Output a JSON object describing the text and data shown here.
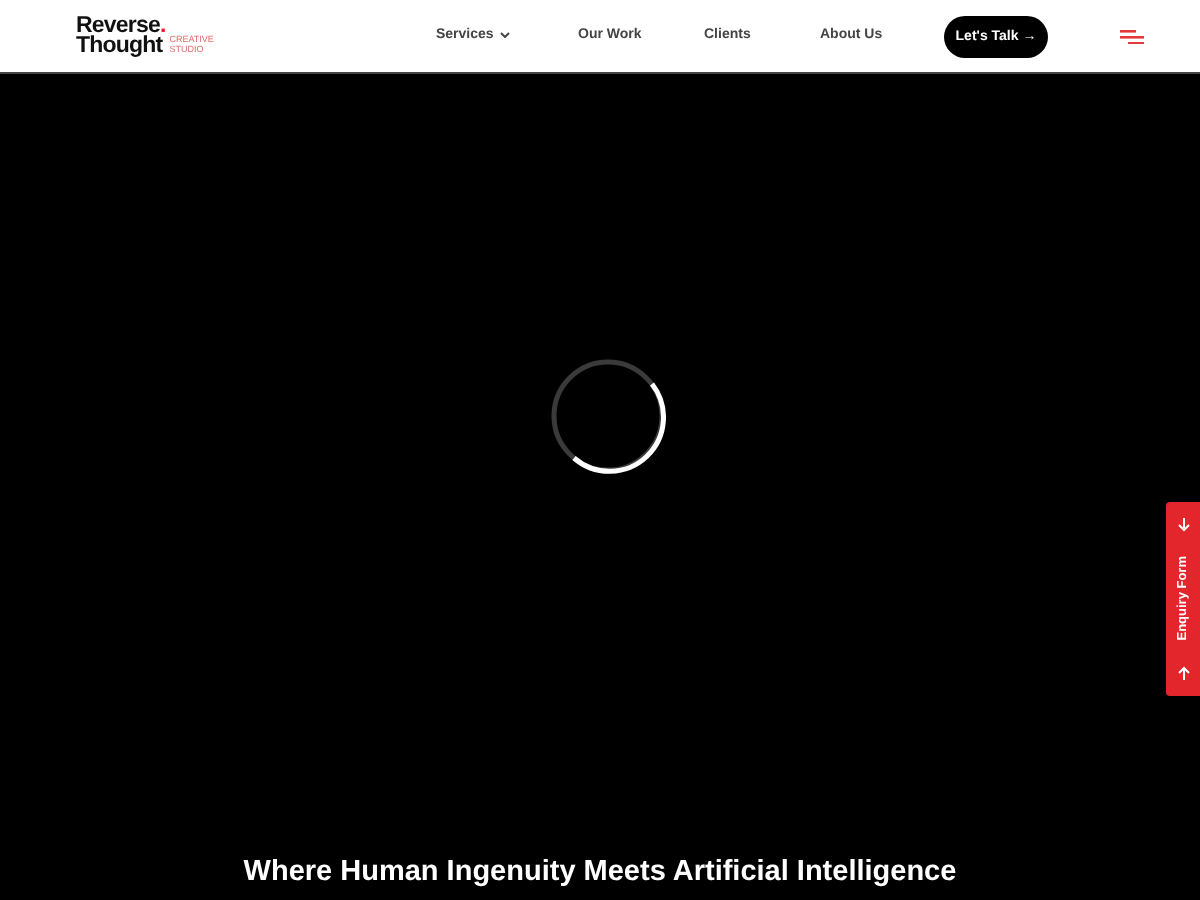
{
  "header": {
    "logo": {
      "line1": "Reverse.",
      "line2": "Thought",
      "tagline": [
        "CREATIVE",
        "STUDIO"
      ]
    },
    "nav": [
      {
        "label": "Services",
        "dropdown": true
      },
      {
        "label": "Our Work",
        "dropdown": false
      },
      {
        "label": "Clients",
        "dropdown": false
      },
      {
        "label": "About Us",
        "dropdown": false
      }
    ],
    "cta": "Let's Talk →"
  },
  "hero": {
    "heading": "Where Human Ingenuity Meets Artificial Intelligence"
  },
  "side_tab": {
    "label": "Enquiry Form"
  }
}
